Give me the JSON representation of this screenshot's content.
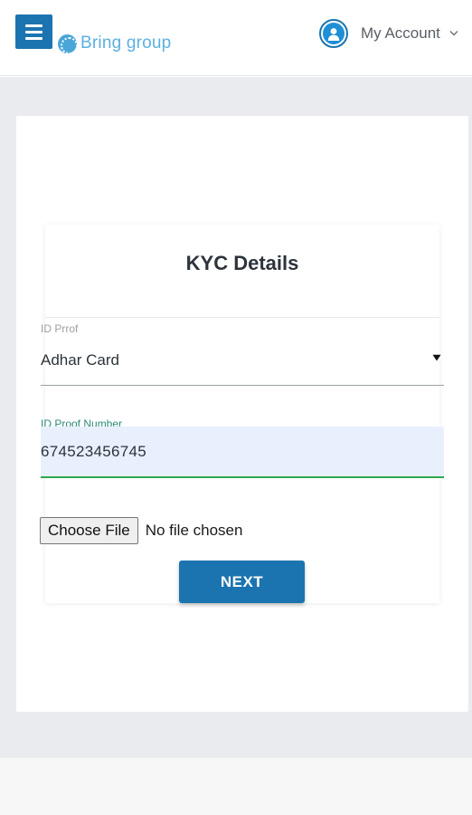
{
  "header": {
    "brand_name": "Bring group",
    "account_label": "My Account",
    "menu_icon": "hamburger-menu-icon",
    "avatar_icon": "user-avatar-icon",
    "account_chevron_icon": "chevron-down-icon"
  },
  "form": {
    "title": "KYC Details",
    "id_proof": {
      "label": "ID Prrof",
      "selected_value": "Adhar Card",
      "arrow_icon": "dropdown-arrow-icon"
    },
    "id_proof_number": {
      "label": "ID Proof Number",
      "value": "674523456745"
    },
    "file_upload": {
      "button_label": "Choose File",
      "status_text": "No file chosen"
    },
    "next_button_label": "NEXT"
  },
  "colors": {
    "primary": "#1b74b0",
    "brand_text": "#5bb0df",
    "page_background": "#e9ebee",
    "input_focus_background": "#e8f0fe",
    "input_focus_border": "#2fa84f"
  }
}
